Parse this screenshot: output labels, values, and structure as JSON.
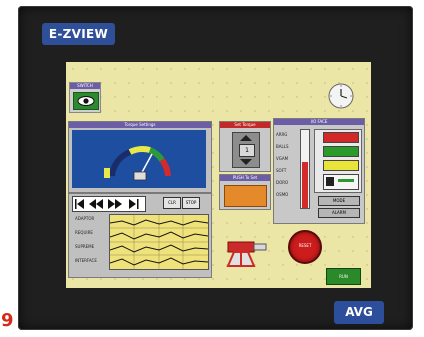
{
  "device": {
    "brand": "E-ZVIEW",
    "badge": "AVG",
    "corner_fragment": "9"
  },
  "screen": {
    "switch_label": "SWITCH",
    "torque_settings_title": "Torque Settings",
    "set_torque_title": "Set Torque",
    "set_torque_value": "1",
    "push_to_set_label": "PUSH To Set",
    "clr_button": "CLR",
    "stop_button": "STOP",
    "trend_labels": [
      "ADAPTOR",
      "REQUIRE",
      "SUPREME",
      "INTERFACE"
    ],
    "io_title": "I/O FACE",
    "io_labels": [
      "ARRG",
      "BALLS",
      "VGAM",
      "SOFT",
      "DORO",
      "OSMO"
    ],
    "mode_button": "MODE",
    "alarm_button": "ALARM",
    "reset_button": "RESET",
    "run_button": "RUN",
    "gauge_level": 0.7
  },
  "colors": {
    "screen_bg": "#ece6a6",
    "panel_blue": "#1d4ea0",
    "title_purple": "#6b5ea6",
    "accent_orange": "#e58a2a",
    "reset_red": "#cc1c1c",
    "run_green": "#2a8a2a"
  }
}
